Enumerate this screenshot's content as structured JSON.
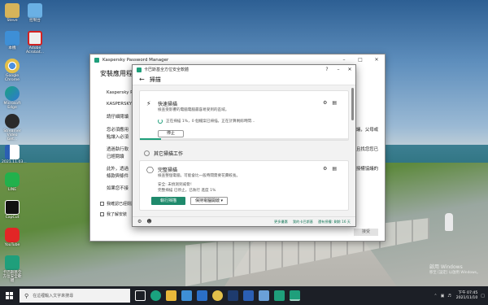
{
  "desktop": {
    "icons": [
      {
        "label": "Steve",
        "icon": "user-folder-icon",
        "color": "#d6b45a"
      },
      {
        "label": "本機",
        "icon": "this-pc-icon",
        "color": "#3e8fd6"
      },
      {
        "label": "Adobe Acrobat...",
        "icon": "acrobat-icon",
        "color": "#e6e6e6"
      },
      {
        "label": "Google Chrome",
        "icon": "chrome-icon",
        "color": "#e3c04a"
      },
      {
        "label": "控制台",
        "icon": "control-panel-icon",
        "color": "#6ab0e4"
      },
      {
        "label": "Microsoft Edge",
        "icon": "edge-icon",
        "color": "#1aa37f"
      },
      {
        "label": "Streamer Video Get...",
        "icon": "camera-app-icon",
        "color": "#2a2a2a"
      },
      {
        "label": "2021.11.03...",
        "icon": "word-doc-icon",
        "color": "#2b5fb3"
      },
      {
        "label": "LINE",
        "icon": "line-icon",
        "color": "#22b14c"
      },
      {
        "label": "CapCut",
        "icon": "capcut-icon",
        "color": "#111111"
      },
      {
        "label": "YouTube",
        "icon": "youtube-icon",
        "color": "#e22626"
      },
      {
        "label": "卡巴斯基全方位安全軟體",
        "icon": "kaspersky-icon",
        "color": "#1f9f7b"
      }
    ],
    "watermark": [
      "啟用 Windows",
      "移至 [設定] 以啟用 Windows。"
    ]
  },
  "back_window": {
    "title": "Kaspersky Password Manager",
    "heading": "安裝應用程式",
    "lines_left": [
      "Kaspersky P",
      "KASPERSKY",
      "請仔細閱讀",
      "您必須應用",
      "點讓入必須",
      "透過執行軟",
      "已經閱讀",
      "此外，透過",
      "條款與條件",
      "如果您不接"
    ],
    "lines_right": [
      "授權協議，父母或",
      "且找您您已",
      "授權協議的"
    ],
    "checkbox1": "我確認已經閱讀",
    "checkbox2": "我了解安裝",
    "button": "接受"
  },
  "front_window": {
    "title": "卡巴斯基全方位安全軟體",
    "header": "掃描",
    "quick_scan": {
      "title": "快速掃描",
      "desc": "檢查受影響的電腦電腦最容易受到的區域。",
      "status": "正在掃描 1%，0 個檔案已掃描，正在計算剩餘時間...",
      "stop": "停止",
      "progress": 0.01
    },
    "other_tasks": "其它掃描工作",
    "full_scan": {
      "title": "完整掃描",
      "desc": "檢查整個電腦，可能會比一般時間需要花費較長。",
      "line1": "安全: 未偵測到威脅！",
      "line2": "完整掃描 已停止。已執行 進度 1%",
      "run": "執行掃描",
      "select": "保持電腦開啟"
    },
    "footer_links": [
      "更多優惠",
      "我的卡巴斯基",
      "還有授權: 剩餘 16 天"
    ]
  },
  "taskbar": {
    "search_placeholder": "在這裡輸入文字來搜尋",
    "apps": [
      {
        "icon": "task-view-icon",
        "color": "#ffffff"
      },
      {
        "icon": "edge-icon",
        "color": "#1aa37f"
      },
      {
        "icon": "file-explorer-icon",
        "color": "#e9b83a"
      },
      {
        "icon": "store-icon",
        "color": "#3e8fd6"
      },
      {
        "icon": "mail-icon",
        "color": "#2b6fc7"
      },
      {
        "icon": "chrome-icon",
        "color": "#e3c04a"
      },
      {
        "icon": "photoshop-icon",
        "color": "#1e3b6e"
      },
      {
        "icon": "word-icon",
        "color": "#2b5fb3"
      },
      {
        "icon": "photos-icon",
        "color": "#6aa0d8"
      },
      {
        "icon": "kaspersky-icon",
        "color": "#1f9f7b"
      },
      {
        "icon": "password-manager-icon",
        "color": "#1f9f7b"
      }
    ],
    "time": "下午 07:45",
    "date": "2021/11/10"
  }
}
